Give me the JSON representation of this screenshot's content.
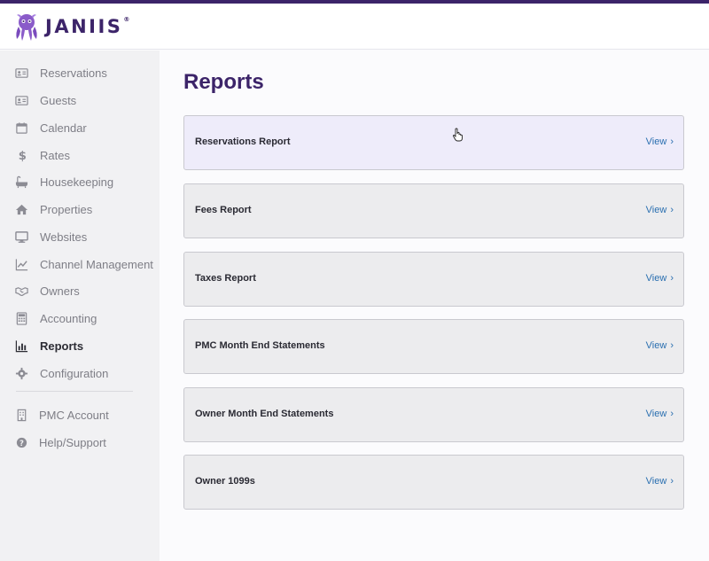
{
  "brand": {
    "name": "JANIIS",
    "tm": "®",
    "color": "#3c2469"
  },
  "sidebar": {
    "items": [
      {
        "label": "Reservations",
        "icon": "id-card-icon"
      },
      {
        "label": "Guests",
        "icon": "id-card-icon"
      },
      {
        "label": "Calendar",
        "icon": "calendar-icon"
      },
      {
        "label": "Rates",
        "icon": "dollar-icon"
      },
      {
        "label": "Housekeeping",
        "icon": "bathtub-icon"
      },
      {
        "label": "Properties",
        "icon": "home-icon"
      },
      {
        "label": "Websites",
        "icon": "monitor-icon"
      },
      {
        "label": "Channel Management",
        "icon": "line-chart-icon"
      },
      {
        "label": "Owners",
        "icon": "handshake-icon"
      },
      {
        "label": "Accounting",
        "icon": "calculator-icon"
      },
      {
        "label": "Reports",
        "icon": "bar-chart-icon",
        "active": true
      },
      {
        "label": "Configuration",
        "icon": "gear-icon"
      }
    ],
    "secondary": [
      {
        "label": "PMC Account",
        "icon": "building-icon"
      },
      {
        "label": "Help/Support",
        "icon": "question-circle-icon"
      }
    ]
  },
  "main": {
    "title": "Reports",
    "view_label": "View",
    "chevron": "›",
    "reports": [
      {
        "name": "Reservations Report"
      },
      {
        "name": "Fees Report"
      },
      {
        "name": "Taxes Report"
      },
      {
        "name": "PMC Month End Statements"
      },
      {
        "name": "Owner Month End Statements"
      },
      {
        "name": "Owner 1099s"
      }
    ]
  },
  "colors": {
    "accent": "#3c2469",
    "link": "#2a6fb0",
    "sidebar_bg": "#f1f1f3",
    "card_bg": "#ececee",
    "card_hover_bg": "#eeecfa"
  }
}
